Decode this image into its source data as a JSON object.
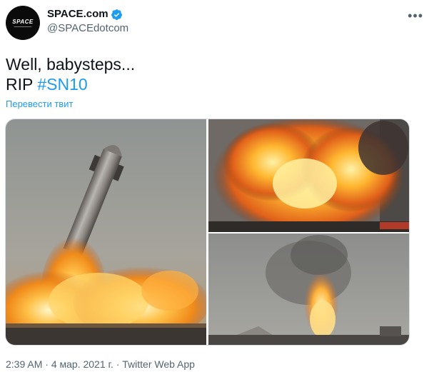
{
  "author": {
    "avatar_text": "SPACE",
    "display_name": "SPACE.com",
    "handle": "@SPACEdotcom",
    "verified_icon": "verified-badge-icon"
  },
  "more_icon": "more-dots-icon",
  "tweet": {
    "line1": "Well, babysteps...",
    "line2_prefix": "RIP ",
    "hashtag": "#SN10"
  },
  "translate_label": "Перевести твит",
  "meta": {
    "time": "2:39 AM",
    "separator": " · ",
    "date": "4 мар. 2021 г.",
    "source": "Twitter Web App"
  },
  "colors": {
    "accent": "#1d9bf0",
    "text": "#0f1419",
    "secondary": "#536471"
  }
}
